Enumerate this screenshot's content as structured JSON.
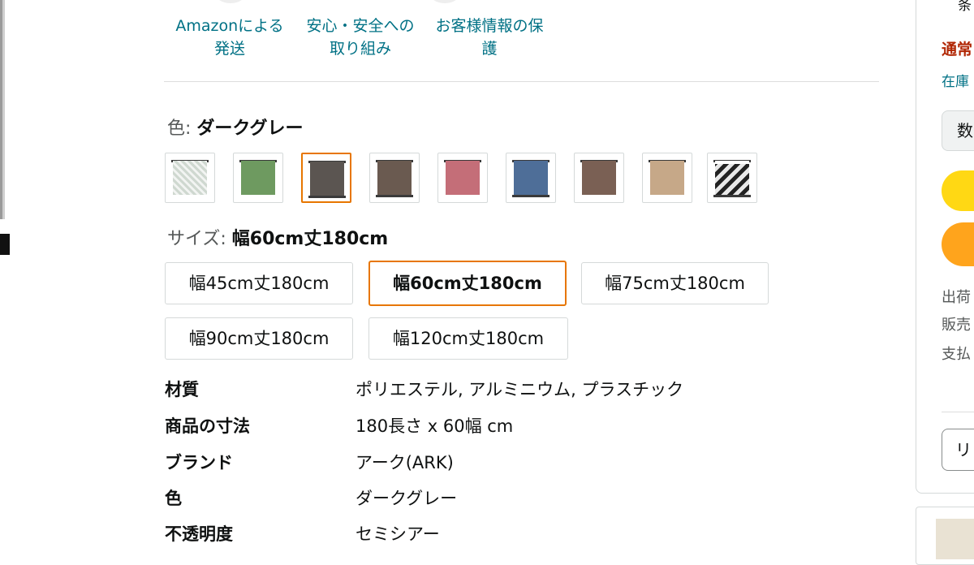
{
  "trust_badges": [
    {
      "line1": "Amazonによる",
      "line2": "発送"
    },
    {
      "line1": "安心・安全への",
      "line2": "取り組み"
    },
    {
      "line1": "お客様情報の保",
      "line2": "護"
    }
  ],
  "variation_color": {
    "label": "色:",
    "value": "ダークグレー"
  },
  "color_swatches": [
    {
      "color": "#dfe5df",
      "pattern": "geometric"
    },
    {
      "color": "#6e9a60"
    },
    {
      "color": "#5b5551",
      "selected": true
    },
    {
      "color": "#6a5a50"
    },
    {
      "color": "#c46e78"
    },
    {
      "color": "#4e6e98"
    },
    {
      "color": "#7a6054"
    },
    {
      "color": "#c6a888"
    },
    {
      "color": "#e6e6e6",
      "pattern": "diamond"
    }
  ],
  "variation_size": {
    "label": "サイズ:",
    "value": "幅60cm丈180cm"
  },
  "size_options": [
    {
      "label": "幅45cm丈180cm"
    },
    {
      "label": "幅60cm丈180cm",
      "selected": true
    },
    {
      "label": "幅75cm丈180cm"
    },
    {
      "label": "幅90cm丈180cm"
    },
    {
      "label": "幅120cm丈180cm"
    }
  ],
  "specs": [
    {
      "key": "材質",
      "value": "ポリエステル, アルミニウム, プラスチック"
    },
    {
      "key": "商品の寸法",
      "value": "180長さ x 60幅 cm"
    },
    {
      "key": "ブランド",
      "value": "アーク(ARK)"
    },
    {
      "key": "色",
      "value": "ダークグレー"
    },
    {
      "key": "不透明度",
      "value": "セミシアー"
    }
  ],
  "buybox": {
    "top_char": "条",
    "shipping_type": "通常",
    "stock": "在庫",
    "quantity_label": "数",
    "ship_from": "出荷",
    "sold_by": "販売",
    "payment": "支払",
    "list_button": "リ"
  },
  "colors": {
    "accent_orange": "#e77600",
    "link_teal": "#007185",
    "price_red": "#b12704",
    "cart_yellow": "#ffd814",
    "buy_orange": "#ffa41c"
  }
}
